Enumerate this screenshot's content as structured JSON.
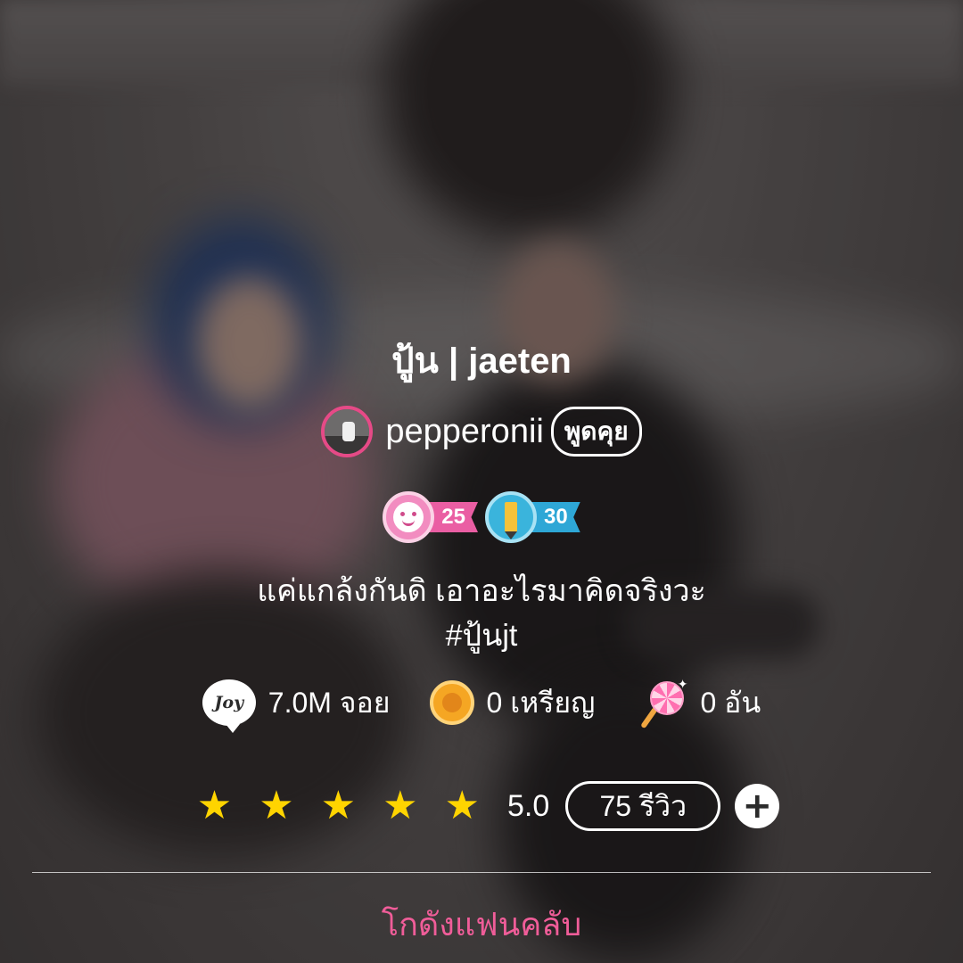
{
  "profile": {
    "title": "ปู้น | jaeten",
    "owner_name": "pepperonii",
    "chat_label": "พูดคุย",
    "badges": [
      {
        "icon": "smiley-badge-icon",
        "level": "25",
        "color": "#ea5ea3"
      },
      {
        "icon": "pencil-badge-icon",
        "level": "30",
        "color": "#2ea7d6"
      }
    ],
    "description_line1": "แค่แกล้งกันดิ เอาอะไรมาคิดจริงวะ",
    "description_line2": "#ปู้นjt"
  },
  "stats": {
    "joy": {
      "icon": "joy-icon",
      "value": "7.0M จอย"
    },
    "coins": {
      "icon": "coin-icon",
      "value": "0 เหรียญ"
    },
    "candy": {
      "icon": "lollipop-icon",
      "value": "0 อัน"
    }
  },
  "rating": {
    "stars": 5,
    "score": "5.0",
    "reviews_label": "75 รีวิว",
    "star_color": "#ffd400"
  },
  "fanclub": {
    "label": "โกดังแฟนคลับ",
    "color": "#f05d99"
  },
  "colors": {
    "avatar_ring": "#e64a87"
  }
}
